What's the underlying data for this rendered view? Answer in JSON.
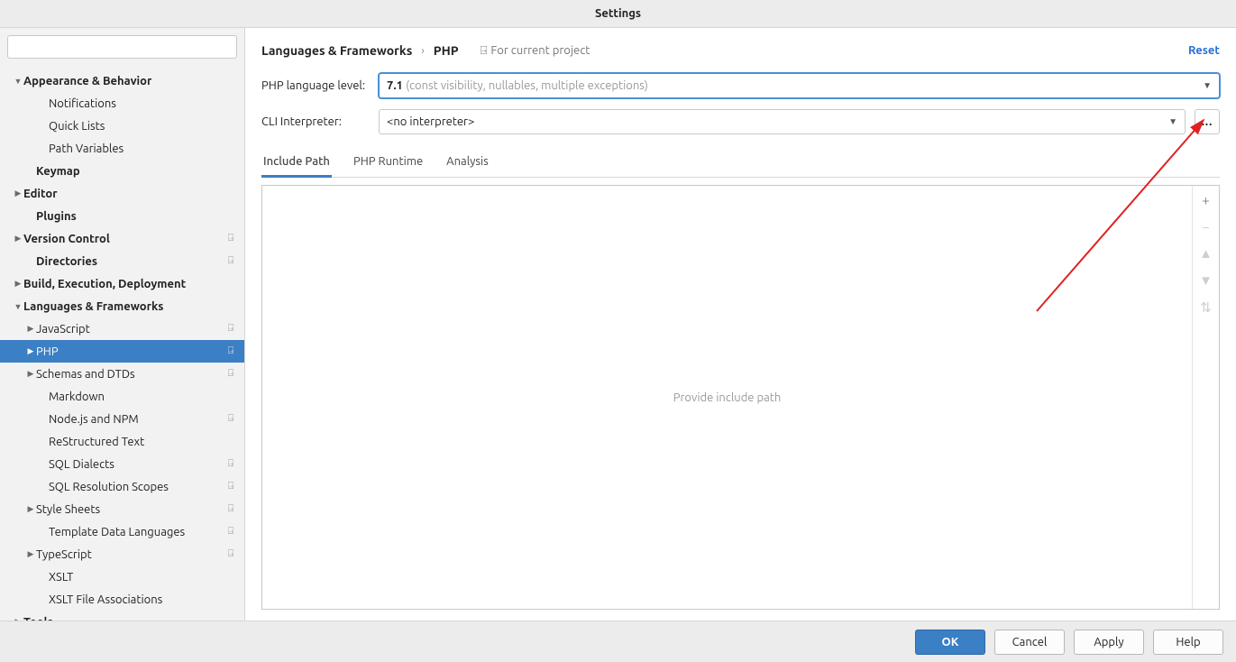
{
  "windowTitle": "Settings",
  "searchPlaceholder": "",
  "tree": [
    {
      "label": "Appearance & Behavior",
      "bold": true,
      "arrow": "down",
      "pad": 0,
      "proj": false
    },
    {
      "label": "Notifications",
      "pad": 2,
      "proj": false
    },
    {
      "label": "Quick Lists",
      "pad": 2,
      "proj": false
    },
    {
      "label": "Path Variables",
      "pad": 2,
      "proj": false
    },
    {
      "label": "Keymap",
      "bold": true,
      "pad": 1,
      "proj": false
    },
    {
      "label": "Editor",
      "bold": true,
      "arrow": "right",
      "pad": 0,
      "proj": false
    },
    {
      "label": "Plugins",
      "bold": true,
      "pad": 1,
      "proj": false
    },
    {
      "label": "Version Control",
      "bold": true,
      "arrow": "right",
      "pad": 0,
      "proj": true
    },
    {
      "label": "Directories",
      "bold": true,
      "pad": 1,
      "proj": true
    },
    {
      "label": "Build, Execution, Deployment",
      "bold": true,
      "arrow": "right",
      "pad": 0,
      "proj": false
    },
    {
      "label": "Languages & Frameworks",
      "bold": true,
      "arrow": "down",
      "pad": 0,
      "proj": false
    },
    {
      "label": "JavaScript",
      "arrow": "right",
      "pad": 1,
      "proj": true
    },
    {
      "label": "PHP",
      "arrow": "right",
      "pad": 1,
      "proj": true,
      "selected": true
    },
    {
      "label": "Schemas and DTDs",
      "arrow": "right",
      "pad": 1,
      "proj": true
    },
    {
      "label": "Markdown",
      "pad": 2,
      "proj": false
    },
    {
      "label": "Node.js and NPM",
      "pad": 2,
      "proj": true
    },
    {
      "label": "ReStructured Text",
      "pad": 2,
      "proj": false
    },
    {
      "label": "SQL Dialects",
      "pad": 2,
      "proj": true
    },
    {
      "label": "SQL Resolution Scopes",
      "pad": 2,
      "proj": true
    },
    {
      "label": "Style Sheets",
      "arrow": "right",
      "pad": 1,
      "proj": true
    },
    {
      "label": "Template Data Languages",
      "pad": 2,
      "proj": true
    },
    {
      "label": "TypeScript",
      "arrow": "right",
      "pad": 1,
      "proj": true
    },
    {
      "label": "XSLT",
      "pad": 2,
      "proj": false
    },
    {
      "label": "XSLT File Associations",
      "pad": 2,
      "proj": false
    },
    {
      "label": "Tools",
      "bold": true,
      "arrow": "right",
      "pad": 0,
      "proj": false
    }
  ],
  "breadcrumb": {
    "part1": "Languages & Frameworks",
    "part2": "PHP",
    "projectNote": "For current project",
    "reset": "Reset"
  },
  "form": {
    "langLevelLabel": "PHP language level:",
    "langLevelValue": "7.1 ",
    "langLevelHint": "(const visibility, nullables, multiple exceptions)",
    "cliLabel": "CLI Interpreter:",
    "cliValue": "<no interpreter>",
    "browse": "..."
  },
  "tabs": {
    "t1": "Include Path",
    "t2": "PHP Runtime",
    "t3": "Analysis"
  },
  "includeEmpty": "Provide include path",
  "buttons": {
    "ok": "OK",
    "cancel": "Cancel",
    "apply": "Apply",
    "help": "Help"
  },
  "icons": {
    "plus": "+",
    "minus": "−",
    "up": "▲",
    "down": "▼",
    "sort": "⇅",
    "dropdown": "▼",
    "chevRight": "›",
    "projGlyph": "⍈"
  }
}
